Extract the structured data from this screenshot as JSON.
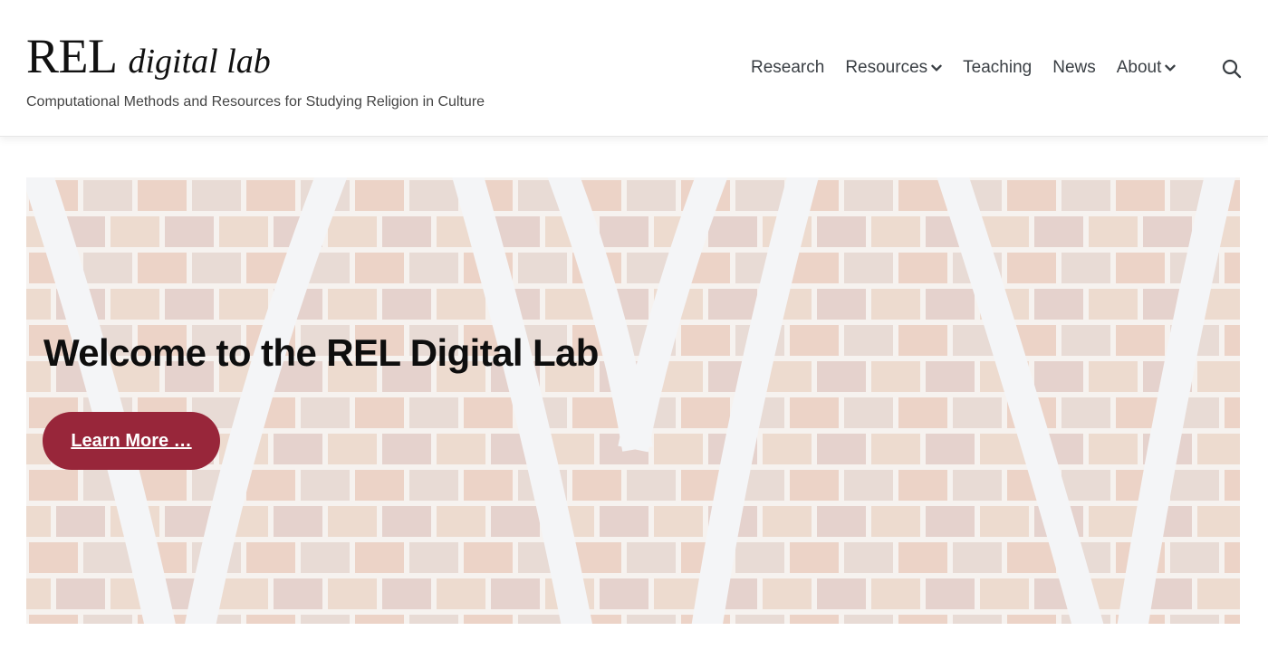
{
  "site": {
    "title_main": "REL",
    "title_sub": "digital lab",
    "tagline": "Computational Methods and Resources for Studying Religion in Culture"
  },
  "nav": {
    "items": [
      {
        "label": "Research",
        "has_dropdown": false
      },
      {
        "label": "Resources",
        "has_dropdown": true
      },
      {
        "label": "Teaching",
        "has_dropdown": false
      },
      {
        "label": "News",
        "has_dropdown": false
      },
      {
        "label": "About",
        "has_dropdown": true
      }
    ],
    "search_icon": "search-icon"
  },
  "hero": {
    "heading": "Welcome to the REL Digital Lab",
    "button_label": "Learn More …",
    "background": "brick wall with white curved arches"
  },
  "colors": {
    "accent": "#98263a",
    "text_dark": "#111111",
    "nav_text": "#3a3f44"
  }
}
